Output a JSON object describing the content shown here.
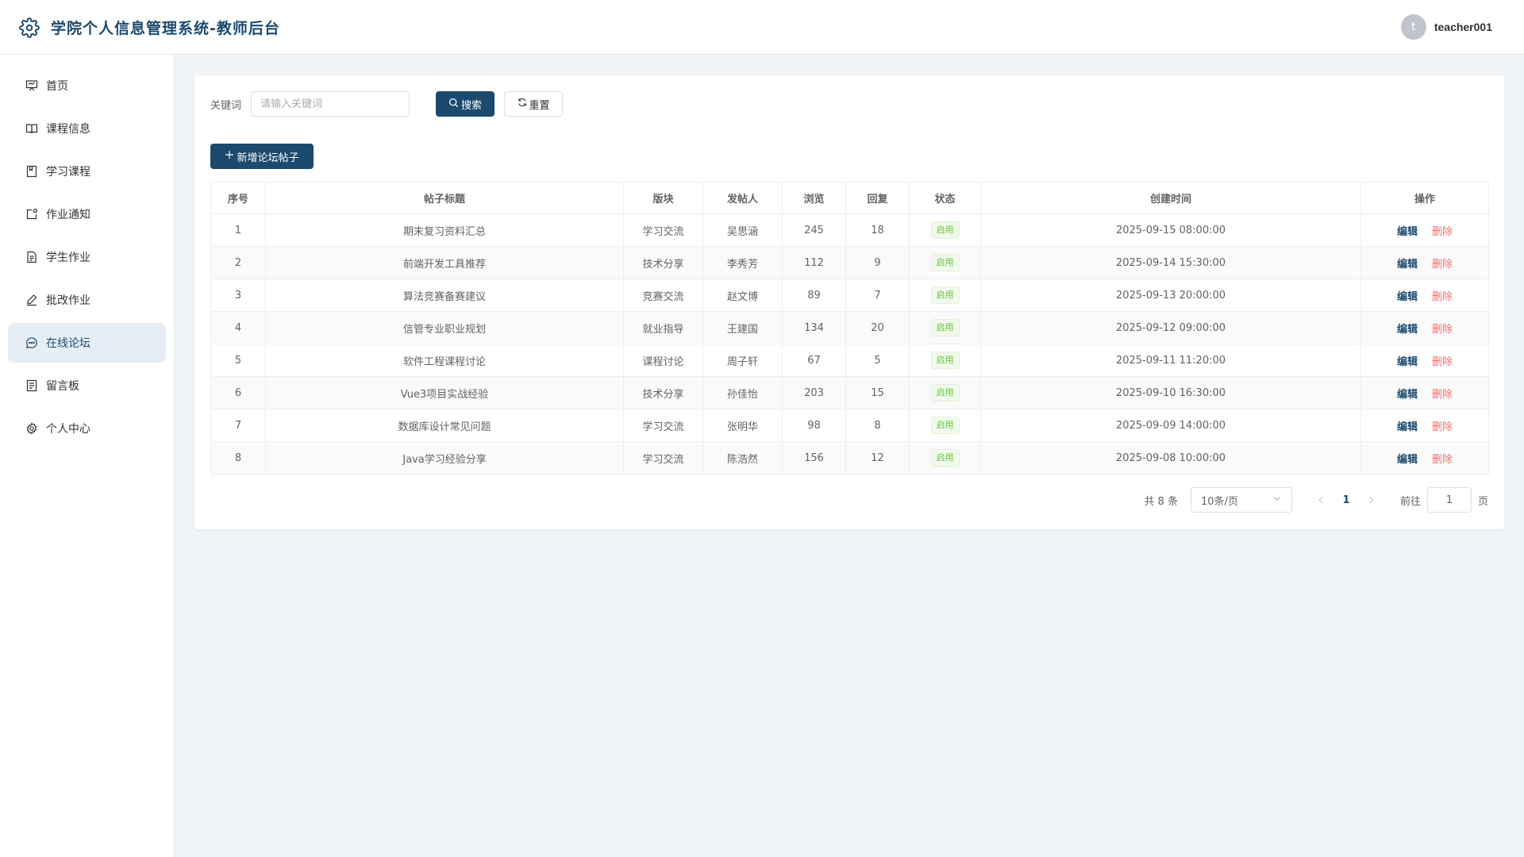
{
  "header": {
    "title": "学院个人信息管理系统-教师后台",
    "logo_icon": "gear-icon",
    "avatar_letter": "t",
    "username": "teacher001"
  },
  "sidebar": {
    "items": [
      {
        "label": "首页",
        "icon": "home-presentation-icon"
      },
      {
        "label": "课程信息",
        "icon": "book-icon"
      },
      {
        "label": "学习课程",
        "icon": "notebook-icon"
      },
      {
        "label": "作业通知",
        "icon": "notification-icon"
      },
      {
        "label": "学生作业",
        "icon": "document-icon"
      },
      {
        "label": "批改作业",
        "icon": "edit-pen-icon"
      },
      {
        "label": "在线论坛",
        "icon": "chat-icon"
      },
      {
        "label": "留言板",
        "icon": "tickets-icon"
      },
      {
        "label": "个人中心",
        "icon": "settings-icon"
      }
    ],
    "active_index": 6
  },
  "search": {
    "keyword_label": "关键词",
    "placeholder": "请输入关键词",
    "value": "",
    "search_label": "搜索",
    "reset_label": "重置"
  },
  "toolbar": {
    "add_label": "新增论坛帖子"
  },
  "table": {
    "columns": [
      "序号",
      "帖子标题",
      "版块",
      "发帖人",
      "浏览",
      "回复",
      "状态",
      "创建时间",
      "操作"
    ],
    "rows": [
      {
        "no": "1",
        "title": "期末复习资料汇总",
        "section": "学习交流",
        "author": "吴思涵",
        "views": "245",
        "replies": "18",
        "status": "启用",
        "created": "2025-09-15 08:00:00"
      },
      {
        "no": "2",
        "title": "前端开发工具推荐",
        "section": "技术分享",
        "author": "李秀芳",
        "views": "112",
        "replies": "9",
        "status": "启用",
        "created": "2025-09-14 15:30:00"
      },
      {
        "no": "3",
        "title": "算法竞赛备赛建议",
        "section": "竞赛交流",
        "author": "赵文博",
        "views": "89",
        "replies": "7",
        "status": "启用",
        "created": "2025-09-13 20:00:00"
      },
      {
        "no": "4",
        "title": "信管专业职业规划",
        "section": "就业指导",
        "author": "王建国",
        "views": "134",
        "replies": "20",
        "status": "启用",
        "created": "2025-09-12 09:00:00"
      },
      {
        "no": "5",
        "title": "软件工程课程讨论",
        "section": "课程讨论",
        "author": "周子轩",
        "views": "67",
        "replies": "5",
        "status": "启用",
        "created": "2025-09-11 11:20:00"
      },
      {
        "no": "6",
        "title": "Vue3项目实战经验",
        "section": "技术分享",
        "author": "孙佳怡",
        "views": "203",
        "replies": "15",
        "status": "启用",
        "created": "2025-09-10 16:30:00"
      },
      {
        "no": "7",
        "title": "数据库设计常见问题",
        "section": "学习交流",
        "author": "张明华",
        "views": "98",
        "replies": "8",
        "status": "启用",
        "created": "2025-09-09 14:00:00"
      },
      {
        "no": "8",
        "title": "Java学习经验分享",
        "section": "学习交流",
        "author": "陈浩然",
        "views": "156",
        "replies": "12",
        "status": "启用",
        "created": "2025-09-08 10:00:00"
      }
    ],
    "edit_label": "编辑",
    "delete_label": "删除"
  },
  "pagination": {
    "total_text": "共 8 条",
    "page_size": "10条/页",
    "current_page": "1",
    "goto_label": "前往",
    "goto_value": "1",
    "page_suffix": "页"
  },
  "colors": {
    "primary": "#1c4a6e",
    "danger": "#f56c6c",
    "success": "#67c23a",
    "background": "#f1f4f7"
  }
}
